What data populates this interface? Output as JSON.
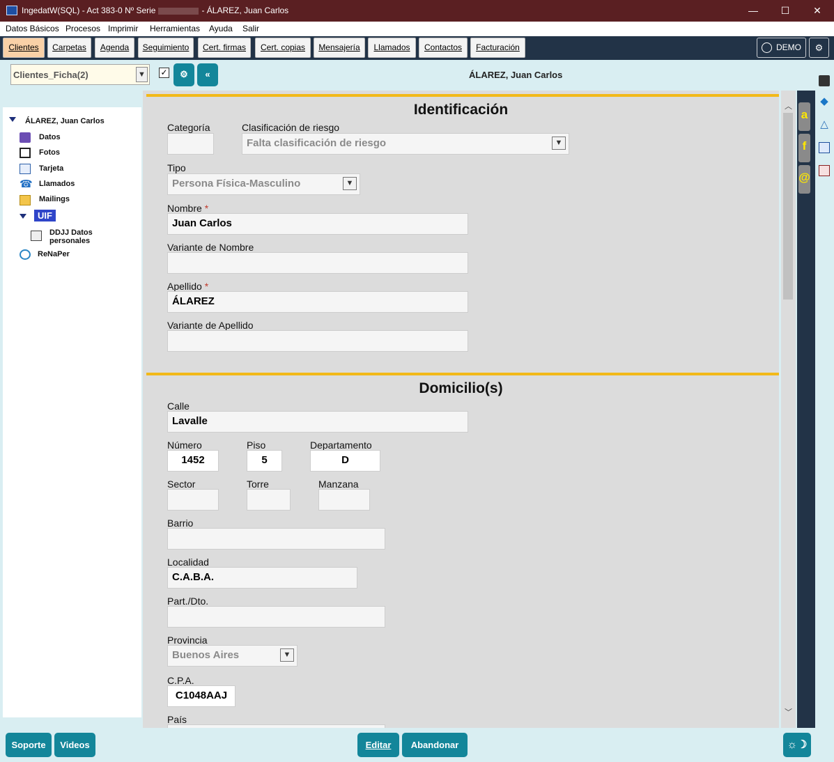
{
  "window": {
    "title_prefix": "IngedatW(SQL) - Act 383-0 Nº Serie",
    "title_suffix": "- ÁLAREZ, Juan Carlos",
    "minimize": "—",
    "maximize": "☐",
    "close": "✕"
  },
  "menu": [
    "Datos Básicos",
    "Procesos",
    "Imprimir",
    "Herramientas",
    "Ayuda",
    "Salir"
  ],
  "tabs": [
    "Clientes",
    "Carpetas",
    "Agenda",
    "Seguimiento",
    "Cert. firmas",
    "Cert. copias",
    "Mensajería",
    "Llamados",
    "Contactos",
    "Facturación"
  ],
  "active_tab": "Clientes",
  "user_label": "DEMO",
  "record_bar": {
    "view_select": "Clientes_Ficha(2)",
    "checkbox_checked": true,
    "btn_options": "⚙",
    "btn_back": "«",
    "record_name": "ÁLAREZ, Juan Carlos"
  },
  "tree": {
    "root": "ÁLAREZ, Juan Carlos",
    "items": [
      "Datos",
      "Fotos",
      "Tarjeta",
      "Llamados",
      "Mailings"
    ],
    "uif": "UIF",
    "uif_child_line1": "DDJJ Datos",
    "uif_child_line2": "personales",
    "renaper": "ReNaPer"
  },
  "identificacion": {
    "title": "Identificación",
    "categoria_label": "Categoría",
    "categoria": "",
    "riesgo_label": "Clasificación de riesgo",
    "riesgo": "Falta clasificación de riesgo",
    "tipo_label": "Tipo",
    "tipo": "Persona Física-Masculino",
    "nombre_label": "Nombre",
    "nombre": "Juan Carlos",
    "var_nombre_label": "Variante de Nombre",
    "var_nombre": "",
    "apellido_label": "Apellido",
    "apellido": "ÁLAREZ",
    "var_apellido_label": "Variante de Apellido",
    "var_apellido": "",
    "required_mark": "*"
  },
  "domicilio": {
    "title": "Domicilio(s)",
    "calle_label": "Calle",
    "calle": "Lavalle",
    "numero_label": "Número",
    "numero": "1452",
    "piso_label": "Piso",
    "piso": "5",
    "depto_label": "Departamento",
    "depto": "D",
    "sector_label": "Sector",
    "torre_label": "Torre",
    "manzana_label": "Manzana",
    "barrio_label": "Barrio",
    "localidad_label": "Localidad",
    "localidad": "C.A.B.A.",
    "partido_label": "Part./Dto.",
    "provincia_label": "Provincia",
    "provincia": "Buenos Aires",
    "cpa_label": "C.P.A.",
    "cpa": "C1048AAJ",
    "pais_label": "País"
  },
  "social": [
    "a",
    "f",
    "@"
  ],
  "bottom": {
    "soporte": "Soporte",
    "videos": "Videos",
    "editar": "Editar",
    "abandonar": "Abandonar"
  }
}
